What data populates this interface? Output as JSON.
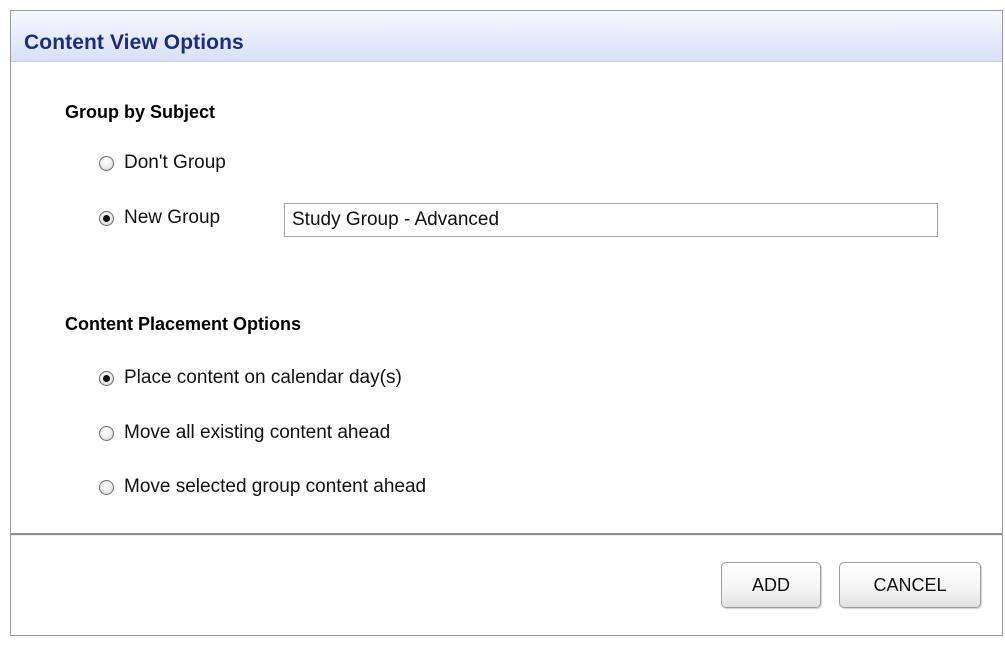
{
  "dialog": {
    "title": "Content View Options"
  },
  "group_by_subject": {
    "heading": "Group by Subject",
    "options": [
      {
        "label": "Don't Group",
        "checked": false
      },
      {
        "label": "New Group",
        "checked": true
      }
    ],
    "new_group_name": "Study Group - Advanced"
  },
  "content_placement": {
    "heading": "Content Placement Options",
    "options": [
      {
        "label": "Place content on calendar day(s)",
        "checked": true
      },
      {
        "label": "Move all existing content ahead",
        "checked": false
      },
      {
        "label": "Move selected group content ahead",
        "checked": false
      }
    ]
  },
  "buttons": {
    "add_label": "ADD",
    "cancel_label": "CANCEL"
  }
}
